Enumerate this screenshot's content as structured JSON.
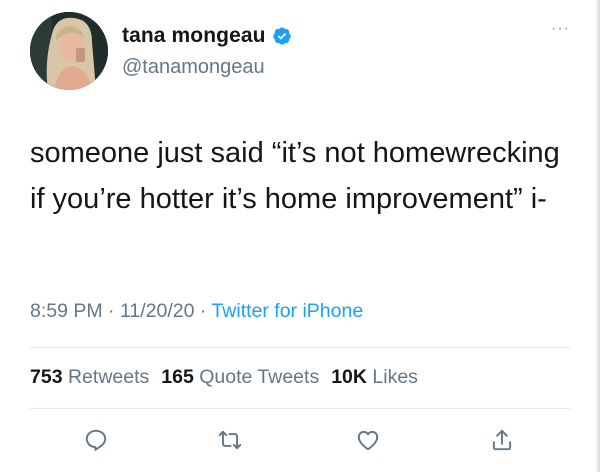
{
  "author": {
    "display_name": "tana mongeau",
    "handle": "@tanamongeau",
    "verified": true
  },
  "tweet": {
    "text": "someone just said “it’s not homewrecking if you’re hotter it’s home improvement” i-",
    "time": "8:59 PM",
    "separator": "·",
    "date": "11/20/20",
    "source": "Twitter for iPhone"
  },
  "stats": {
    "retweets_count": "753",
    "retweets_label": "Retweets",
    "quote_tweets_count": "165",
    "quote_tweets_label": "Quote Tweets",
    "likes_count": "10K",
    "likes_label": "Likes"
  },
  "menu": {
    "more_label": "···"
  },
  "actions": {
    "reply_icon": "reply-icon",
    "retweet_icon": "retweet-icon",
    "like_icon": "heart-icon",
    "share_icon": "share-icon"
  },
  "colors": {
    "accent": "#1da1f2",
    "text": "#14171a",
    "secondary": "#657786",
    "divider": "#e1e8ed"
  }
}
